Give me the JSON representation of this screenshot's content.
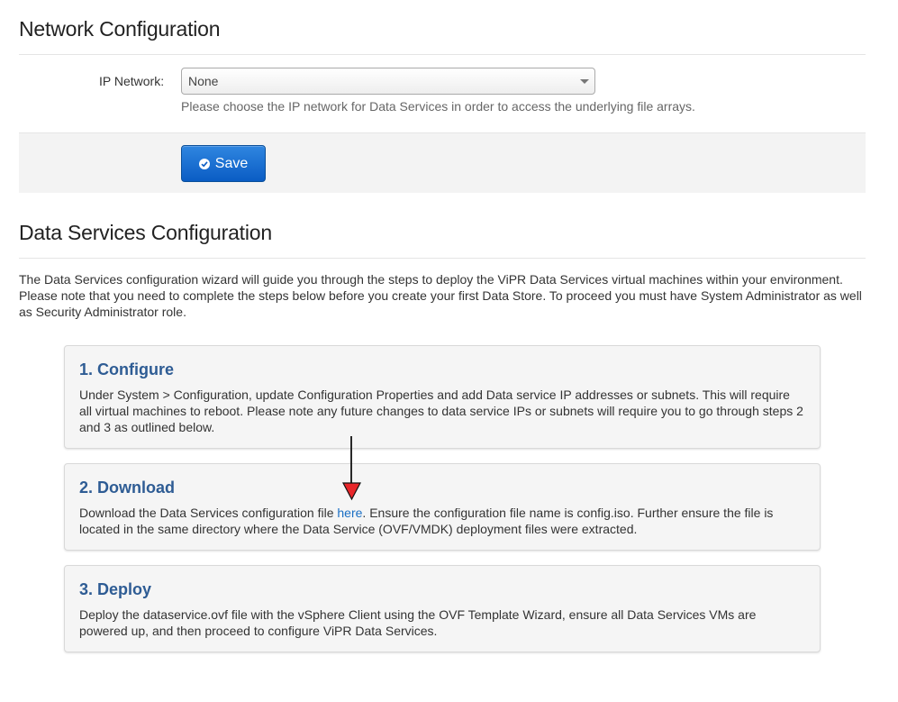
{
  "network": {
    "title": "Network Configuration",
    "ip_label": "IP Network:",
    "ip_selected": "None",
    "help_text": "Please choose the IP network for Data Services in order to access the underlying file arrays.",
    "save_label": "Save"
  },
  "data_services": {
    "title": "Data Services Configuration",
    "intro": "The Data Services configuration wizard will guide you through the steps to deploy the ViPR Data Services virtual machines within your environment. Please note that you need to complete the steps below before you create your first Data Store. To proceed you must have System Administrator as well as Security Administrator role.",
    "steps": [
      {
        "title": "1. Configure",
        "body": "Under System > Configuration, update Configuration Properties and add Data service IP addresses or subnets. This will require all virtual machines to reboot. Please note any future changes to data service IPs or subnets will require you to go through steps 2 and 3 as outlined below."
      },
      {
        "title": "2. Download",
        "body_before": "Download the Data Services configuration file ",
        "link_text": "here",
        "body_after": ". Ensure the configuration file name is config.iso. Further ensure the file is located in the same directory where the Data Service (OVF/VMDK) deployment files were extracted."
      },
      {
        "title": "3. Deploy",
        "body": "Deploy the dataservice.ovf file with the vSphere Client using the OVF Template Wizard, ensure all Data Services VMs are powered up, and then proceed to configure ViPR Data Services."
      }
    ]
  },
  "colors": {
    "step_title": "#2e5c94",
    "link": "#1a6fc4",
    "save_button": "#0a5cc4",
    "annotation_arrow_head": "#e8262a"
  },
  "icons": {
    "save": "check-circle-icon",
    "select": "chevron-down-icon",
    "annotation": "arrow-down-icon"
  }
}
